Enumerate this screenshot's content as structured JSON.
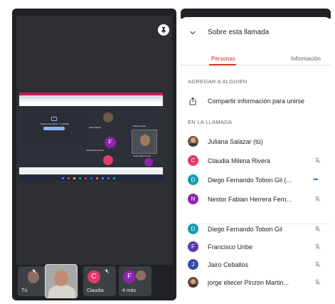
{
  "call": {
    "tiles": [
      {
        "label": "Tú"
      },
      {
        "label": "Claudia",
        "initial": "C",
        "color": "#e53969"
      },
      {
        "label": "4 más",
        "initial": "F",
        "color": "#8e24aa"
      }
    ],
    "shared_screen": {
      "present_text": "Estás presentando tu pantalla",
      "labels": [
        {
          "text": "Juliana Salazar"
        },
        {
          "text": "Claudia Milena Rivera"
        },
        {
          "text": "Nestor Fabian Herrera"
        },
        {
          "text": "Diego Fernando"
        }
      ]
    }
  },
  "panel": {
    "title": "Sobre esta llamada",
    "tabs": {
      "people": "Personas",
      "info": "Información"
    },
    "add_section": "AGREGAR A ALGUIEN",
    "share_label": "Compartir información para unirse",
    "in_call_section": "EN LA LLAMADA",
    "participants": [
      {
        "name": "Juliana Salazar (tú)",
        "initial": "",
        "color": "#6b5a4a",
        "photo": true,
        "muted": false,
        "more": false
      },
      {
        "name": "Claudia Milena Rivera",
        "initial": "C",
        "color": "#e53969",
        "muted": true,
        "more": false
      },
      {
        "name": "Diego Fernando Tobon Gil (...",
        "initial": "D",
        "color": "#129eaf",
        "muted": false,
        "more": true
      },
      {
        "name": "Nestor Fabian Herrera Fern...",
        "initial": "N",
        "color": "#8e24aa",
        "muted": true,
        "more": false
      },
      {
        "name": "Diego Fernando Tobon Gil",
        "initial": "D",
        "color": "#129eaf",
        "muted": true,
        "more": false
      },
      {
        "name": "Francisco Uribe",
        "initial": "F",
        "color": "#5e35b1",
        "muted": true,
        "more": false
      },
      {
        "name": "Jairo Ceballos",
        "initial": "J",
        "color": "#3949ab",
        "muted": true,
        "more": false
      },
      {
        "name": "jorge eliecer Pinzon Martin...",
        "initial": "",
        "color": "#6d4c41",
        "photo": true,
        "muted": true,
        "more": false
      }
    ],
    "more_glyph": "•••"
  },
  "colors": {
    "accent": "#d93025",
    "dark_bg": "#202124",
    "link": "#1a73e8"
  }
}
